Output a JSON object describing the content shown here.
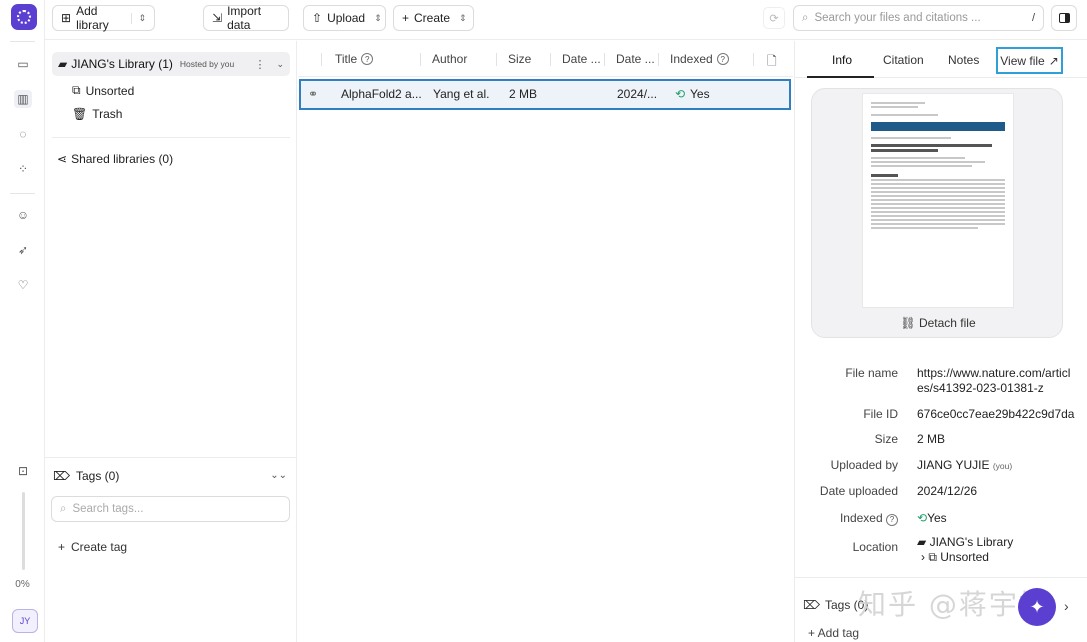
{
  "toolbar": {
    "add_library": "Add library",
    "import_data": "Import data",
    "upload": "Upload",
    "create": "Create",
    "search_placeholder": "Search your files and citations ...",
    "search_shortcut": "/"
  },
  "sidebar": {
    "library_name": "JIANG's Library (1)",
    "library_hosted": "Hosted by you",
    "unsorted": "Unsorted",
    "trash": "Trash",
    "shared_libraries": "Shared libraries (0)",
    "tags_title": "Tags (0)",
    "tags_search_placeholder": "Search tags...",
    "create_tag": "Create tag"
  },
  "rail": {
    "zoom": "0%",
    "avatar_initials": "JY"
  },
  "table": {
    "headers": [
      "Title",
      "Author",
      "Size",
      "Date ...",
      "Date ...",
      "Indexed"
    ],
    "rows": [
      {
        "title": "AlphaFold2 a...",
        "author": "Yang et al.",
        "size": "2 MB",
        "date_added": "",
        "date_modified": "2024/...",
        "indexed": "Yes"
      }
    ]
  },
  "right_panel": {
    "tabs": [
      "Info",
      "Citation",
      "Notes",
      "View file"
    ],
    "active_tab": "Info",
    "detach_file": "Detach file",
    "meta": [
      {
        "label": "File name",
        "value": "https://www.nature.com/articles/s41392-023-01381-z"
      },
      {
        "label": "File ID",
        "value": "676ce0cc7eae29b422c9d7da"
      },
      {
        "label": "Size",
        "value": "2 MB"
      },
      {
        "label": "Uploaded by",
        "value": "JIANG YUJIE",
        "suffix": "(you)"
      },
      {
        "label": "Date uploaded",
        "value": "2024/12/26"
      },
      {
        "label": "Indexed",
        "value": "Yes"
      },
      {
        "label": "Location",
        "value": "JIANG's Library",
        "sub": "Unsorted"
      }
    ],
    "tags": "Tags (0)",
    "add_tag": "+ Add tag"
  },
  "watermark": "知乎 @蒋宇捷",
  "colors": {
    "brand": "#5b3fd0",
    "selection_border": "#2f7fc1",
    "indexed_green": "#22a06b"
  }
}
